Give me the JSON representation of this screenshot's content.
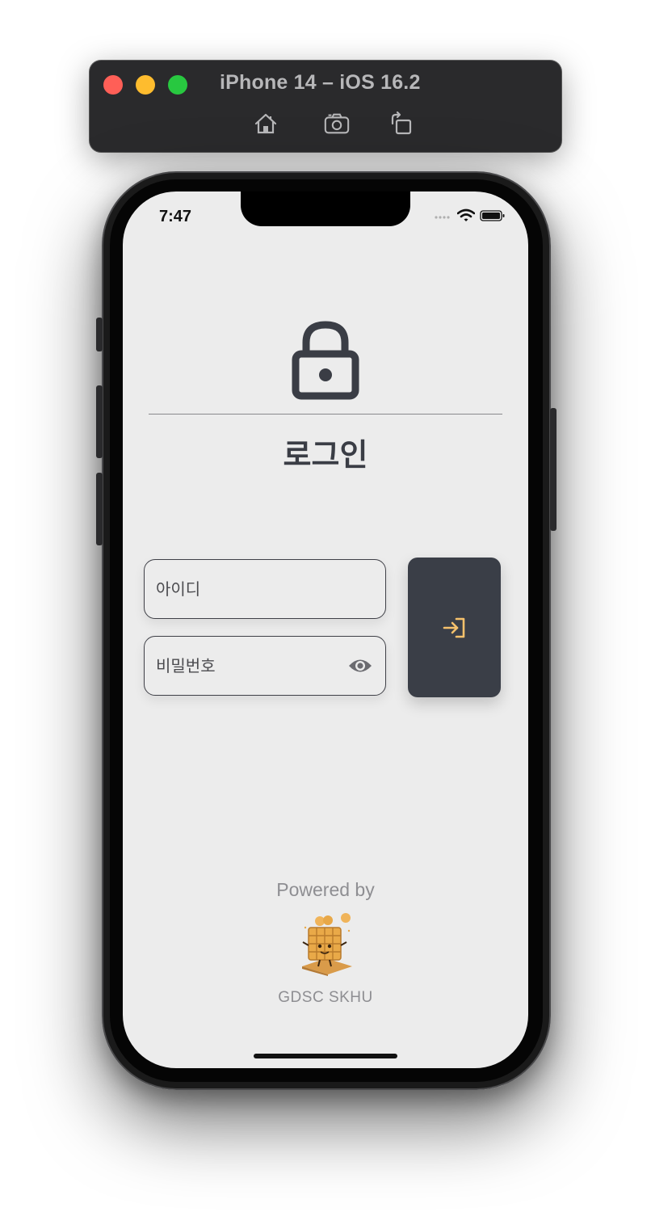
{
  "simulator": {
    "title": "iPhone 14 – iOS 16.2",
    "toolbar": [
      {
        "icon": "home-icon"
      },
      {
        "icon": "screenshot-icon"
      },
      {
        "icon": "rotate-icon"
      }
    ]
  },
  "status_bar": {
    "time": "7:47",
    "icons": [
      "cellular-dots-icon",
      "wifi-icon",
      "battery-icon"
    ]
  },
  "login": {
    "header_icon": "lock-icon",
    "title": "로그인",
    "id_placeholder": "아이디",
    "id_value": "",
    "password_placeholder": "비밀번호",
    "password_value": "",
    "password_toggle_icon": "eye-icon",
    "submit_icon": "login-arrow-icon"
  },
  "footer": {
    "powered_by": "Powered by",
    "logo": "waffle-mascot",
    "org": "GDSC SKHU"
  },
  "colors": {
    "screen_bg": "#ececec",
    "text_dark": "#3a3d45",
    "button_bg": "#3a3e47",
    "button_icon": "#f5c16c",
    "muted_text": "#8e8e92"
  }
}
